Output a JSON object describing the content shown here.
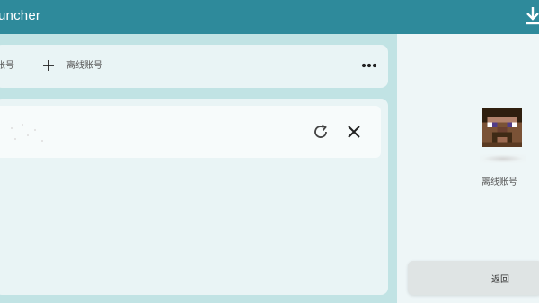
{
  "window": {
    "title": "uncher"
  },
  "toolbar": {
    "account_label": "账号",
    "offline_account_label": "离线账号"
  },
  "right_panel": {
    "account_type": "离线账号",
    "back_label": "返回"
  },
  "icons": {
    "download": "download-icon",
    "add": "plus-icon",
    "more": "more-horizontal-icon",
    "refresh": "refresh-icon",
    "remove": "close-icon"
  },
  "colors": {
    "titlebar": "#2e8a9b",
    "background": "#c1e3e4",
    "card": "#e9f4f5",
    "right_panel": "#eef6f7"
  }
}
